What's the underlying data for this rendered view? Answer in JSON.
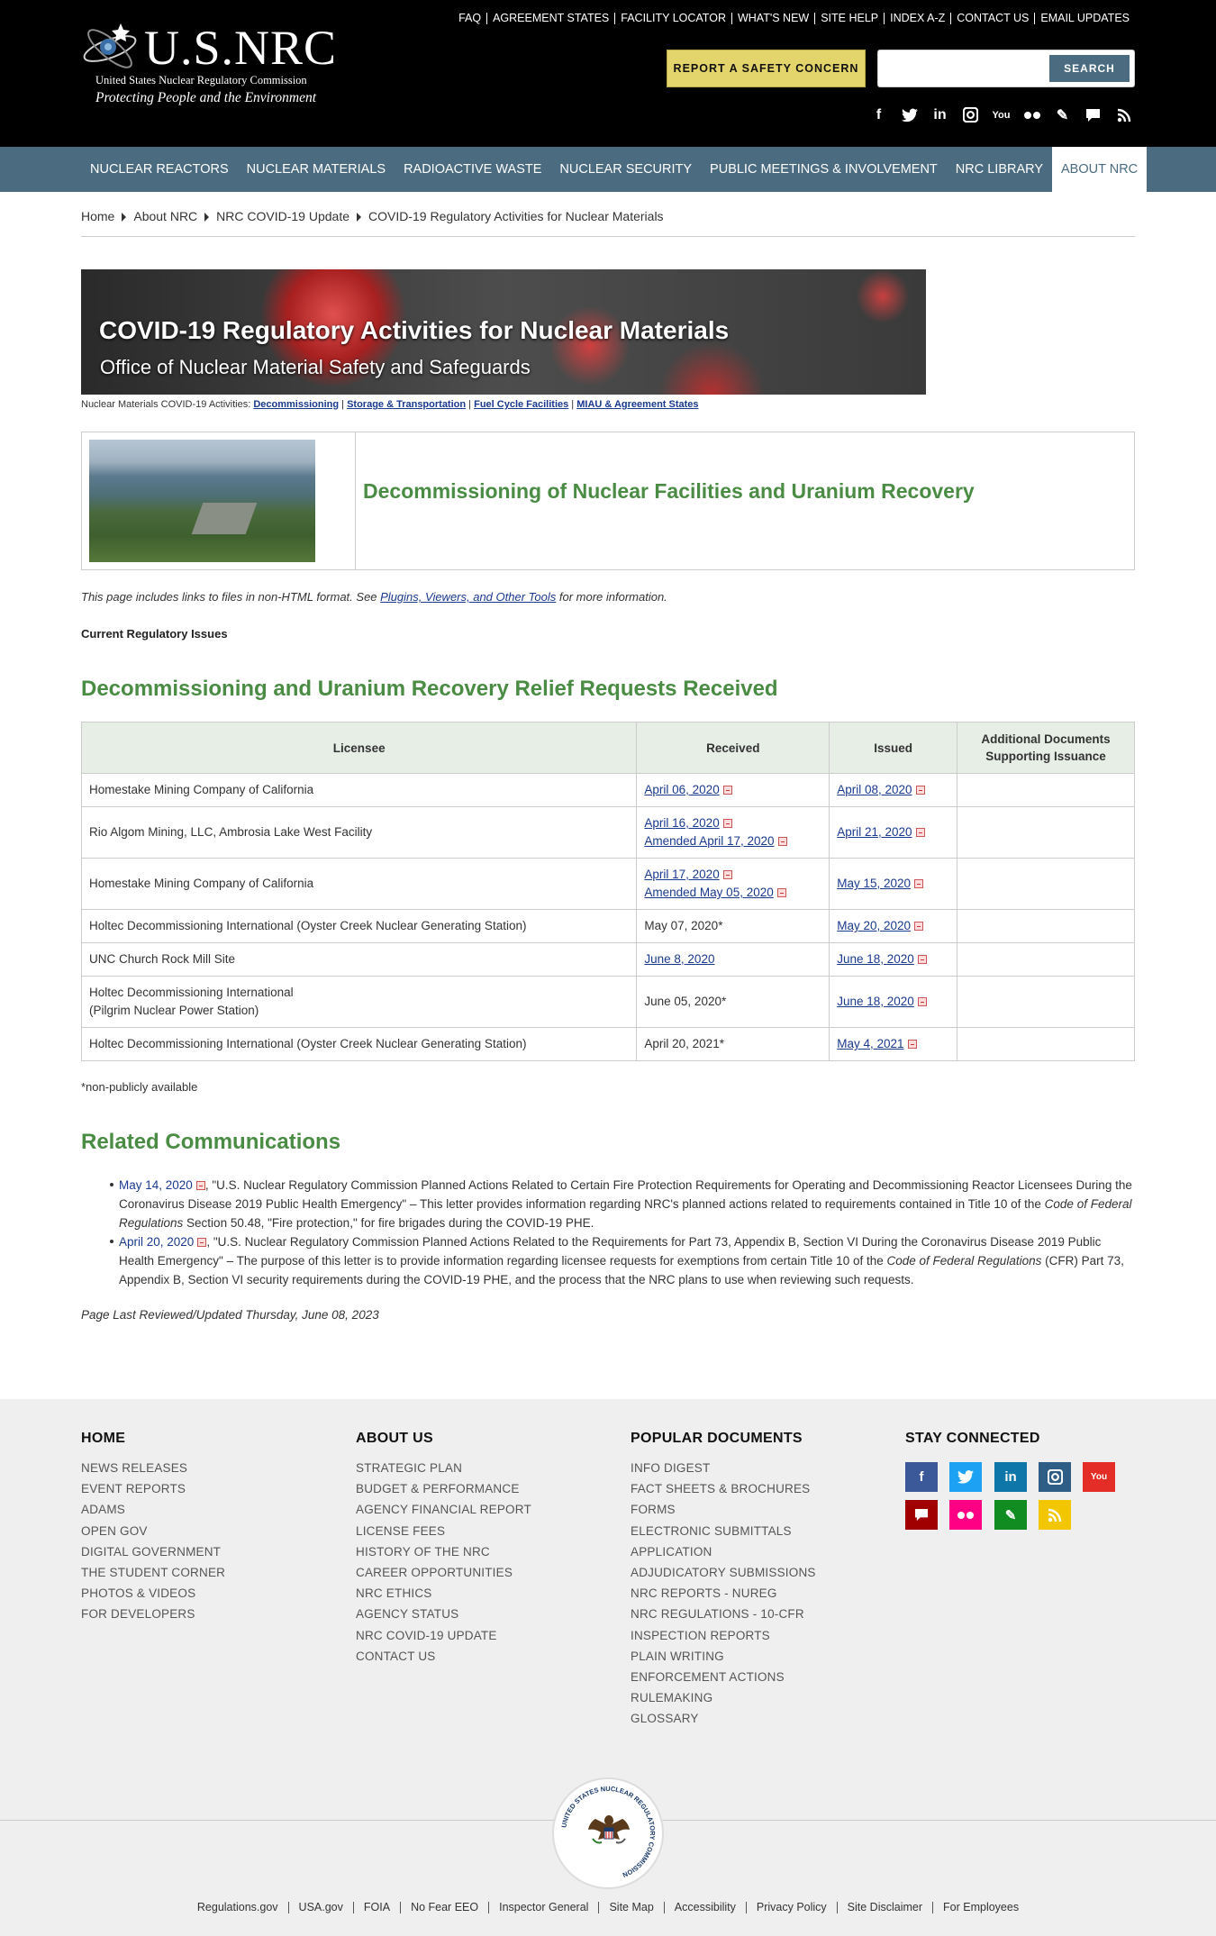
{
  "header": {
    "logo_text": "U.S.NRC",
    "logo_sub1": "United States Nuclear Regulatory Commission",
    "logo_sub2": "Protecting People and the Environment",
    "utility_links": [
      "FAQ",
      "AGREEMENT STATES",
      "FACILITY LOCATOR",
      "WHAT'S NEW",
      "SITE HELP",
      "INDEX A-Z",
      "CONTACT US",
      "EMAIL UPDATES"
    ],
    "report_button": "REPORT A SAFETY CONCERN",
    "search_placeholder": "",
    "search_button": "SEARCH",
    "social_icons": [
      "facebook-icon",
      "twitter-icon",
      "linkedin-icon",
      "instagram-icon",
      "youtube-icon",
      "flickr-icon",
      "blog-icon",
      "comment-icon",
      "rss-icon"
    ]
  },
  "nav": {
    "items": [
      "NUCLEAR REACTORS",
      "NUCLEAR MATERIALS",
      "RADIOACTIVE WASTE",
      "NUCLEAR SECURITY",
      "PUBLIC MEETINGS & INVOLVEMENT",
      "NRC LIBRARY",
      "ABOUT NRC"
    ],
    "active": "ABOUT NRC"
  },
  "breadcrumb": [
    "Home",
    "About NRC",
    "NRC COVID-19 Update",
    "COVID-19 Regulatory Activities for Nuclear Materials"
  ],
  "banner": {
    "title": "COVID-19 Regulatory Activities for Nuclear Materials",
    "subtitle": "Office of Nuclear Material Safety and Safeguards"
  },
  "activities": {
    "prefix": "Nuclear Materials COVID-19 Activities:",
    "links": [
      "Decommissioning",
      "Storage & Transportation",
      "Fuel Cycle Facilities",
      "MIAU & Agreement States"
    ]
  },
  "feature": {
    "title": "Decommissioning of Nuclear Facilities and Uranium Recovery"
  },
  "note": {
    "before": "This page includes links to files in non-HTML format. See ",
    "link": "Plugins, Viewers, and Other Tools",
    "after": " for more information."
  },
  "current_issues": "Current Regulatory Issues",
  "relief_heading": "Decommissioning and Uranium Recovery Relief Requests Received",
  "table": {
    "headers": [
      "Licensee",
      "Received",
      "Issued",
      "Additional Documents Supporting Issuance"
    ],
    "rows": [
      {
        "licensee": "Homestake Mining Company of California",
        "received": [
          {
            "text": "April 06, 2020",
            "link": true,
            "pdf": true
          }
        ],
        "issued": "April 08, 2020"
      },
      {
        "licensee": "Rio Algom Mining, LLC, Ambrosia Lake West Facility",
        "received": [
          {
            "text": "April 16, 2020",
            "link": true,
            "pdf": true
          },
          {
            "text": "Amended April 17, 2020",
            "link": true,
            "pdf": true
          }
        ],
        "issued": "April 21, 2020"
      },
      {
        "licensee": "Homestake Mining Company of California",
        "received": [
          {
            "text": "April 17, 2020",
            "link": true,
            "pdf": true
          },
          {
            "text": "Amended May 05, 2020",
            "link": true,
            "pdf": true
          }
        ],
        "issued": "May 15, 2020"
      },
      {
        "licensee": "Holtec Decommissioning International (Oyster Creek Nuclear Generating Station)",
        "received": [
          {
            "text": "May 07, 2020*",
            "link": false,
            "pdf": false
          }
        ],
        "issued": "May 20, 2020"
      },
      {
        "licensee": "UNC Church Rock Mill Site",
        "received": [
          {
            "text": "June 8, 2020",
            "link": true,
            "pdf": false
          }
        ],
        "issued": "June 18, 2020"
      },
      {
        "licensee": "Holtec Decommissioning International",
        "licensee2": "(Pilgrim Nuclear Power Station)",
        "received": [
          {
            "text": "June 05, 2020*",
            "link": false,
            "pdf": false
          }
        ],
        "issued": "June 18, 2020"
      },
      {
        "licensee": "Holtec Decommissioning International (Oyster Creek Nuclear Generating Station)",
        "received": [
          {
            "text": "April 20, 2021*",
            "link": false,
            "pdf": false
          }
        ],
        "issued": "May 4, 2021"
      }
    ]
  },
  "nonpublic_note": "*non-publicly available",
  "related_heading": "Related Communications",
  "related": [
    {
      "date": "May 14, 2020",
      "p1": ", \"U.S. Nuclear Regulatory Commission Planned Actions Related to Certain Fire Protection Requirements for Operating and Decommissioning Reactor Licensees During the Coronavirus Disease 2019 Public Health Emergency\" – This letter provides information regarding NRC's planned actions related to requirements contained in Title 10 of the ",
      "em": "Code of Federal Regulations",
      "p2": " Section 50.48, \"Fire protection,\" for fire brigades during the COVID-19 PHE."
    },
    {
      "date": "April 20, 2020",
      "p1": ", \"U.S. Nuclear Regulatory Commission Planned Actions Related to the Requirements for Part 73, Appendix B, Section VI During the Coronavirus Disease 2019 Public Health Emergency\" – The purpose of this letter is to provide information regarding licensee requests for exemptions from certain Title 10 of the ",
      "em": "Code of Federal Regulations",
      "p2": " (CFR) Part 73, Appendix B, Section VI security requirements during the COVID-19 PHE, and the process that the NRC plans to use when reviewing such requests."
    }
  ],
  "updated": "Page Last Reviewed/Updated Thursday, June 08, 2023",
  "footer": {
    "columns": [
      {
        "title": "HOME",
        "links": [
          "NEWS RELEASES",
          "EVENT REPORTS",
          "ADAMS",
          "OPEN GOV",
          "DIGITAL GOVERNMENT",
          "THE STUDENT CORNER",
          "PHOTOS & VIDEOS",
          "FOR DEVELOPERS"
        ]
      },
      {
        "title": "ABOUT US",
        "links": [
          "STRATEGIC PLAN",
          "BUDGET & PERFORMANCE",
          "AGENCY FINANCIAL REPORT",
          "LICENSE FEES",
          "HISTORY OF THE NRC",
          "CAREER OPPORTUNITIES",
          "NRC ETHICS",
          "AGENCY STATUS",
          "NRC COVID-19 UPDATE",
          "CONTACT US"
        ]
      },
      {
        "title": "POPULAR DOCUMENTS",
        "links": [
          "INFO DIGEST",
          "FACT SHEETS & BROCHURES",
          "FORMS",
          "ELECTRONIC SUBMITTALS",
          "APPLICATION",
          "ADJUDICATORY SUBMISSIONS",
          "NRC REPORTS - NUREG",
          "NRC REGULATIONS - 10-CFR",
          "INSPECTION REPORTS",
          "PLAIN WRITING",
          "ENFORCEMENT ACTIONS",
          "RULEMAKING",
          "GLOSSARY"
        ]
      }
    ],
    "stay_connected": "STAY CONNECTED",
    "social": [
      {
        "icon": "facebook-icon",
        "color": "#3b5998",
        "glyph": "f"
      },
      {
        "icon": "twitter-icon",
        "color": "#1da1f2",
        "glyph": "t"
      },
      {
        "icon": "linkedin-icon",
        "color": "#0e76a8",
        "glyph": "in"
      },
      {
        "icon": "instagram-icon",
        "color": "#2e5e86",
        "glyph": "◙"
      },
      {
        "icon": "youtube-icon",
        "color": "#e52d27",
        "glyph": "▶"
      },
      {
        "icon": "comment-icon",
        "color": "#a00000",
        "glyph": "▬"
      },
      {
        "icon": "flickr-icon",
        "color": "#ff0084",
        "glyph": "••"
      },
      {
        "icon": "blog-icon",
        "color": "#108c21",
        "glyph": "✎"
      },
      {
        "icon": "rss-icon",
        "color": "#f2c600",
        "glyph": ")))"
      }
    ],
    "seal_text": "UNITED STATES NUCLEAR REGULATORY COMMISSION",
    "bottom_links": [
      "Regulations.gov",
      "USA.gov",
      "FOIA",
      "No Fear EEO",
      "Inspector General",
      "Site Map",
      "Accessibility",
      "Privacy Policy",
      "Site Disclaimer",
      "For Employees"
    ]
  }
}
